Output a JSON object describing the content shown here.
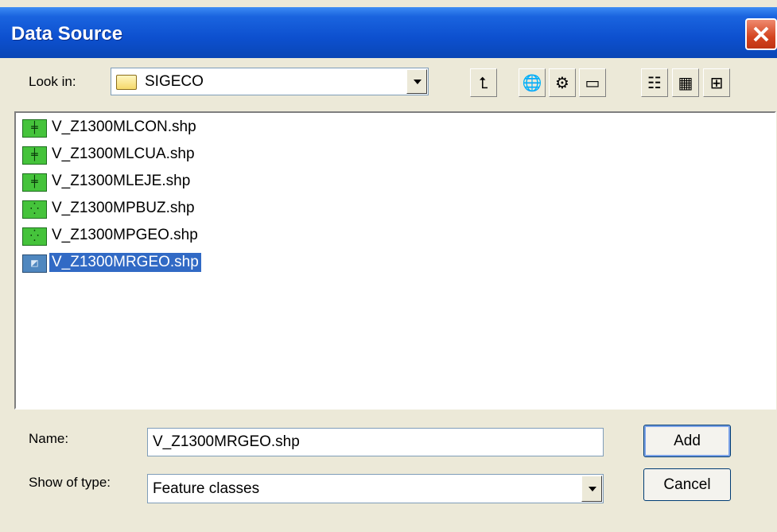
{
  "window": {
    "title": "Data Source"
  },
  "look_in": {
    "label": "Look in:",
    "value": "SIGECO"
  },
  "toolbar": [
    {
      "name": "up-one-level-button",
      "icon": "up-folder-icon",
      "glyph": "⮤"
    },
    {
      "name": "connect-folder-button",
      "icon": "connect-folder-icon",
      "glyph": "🌐"
    },
    {
      "name": "disconnect-folder-button",
      "icon": "disconnect-folder-icon",
      "glyph": "⚙"
    },
    {
      "name": "new-folder-button",
      "icon": "new-folder-icon",
      "glyph": "▭"
    },
    {
      "name": "list-view-button",
      "icon": "list-view-icon",
      "glyph": "☷"
    },
    {
      "name": "details-view-button",
      "icon": "details-view-icon",
      "glyph": "▦"
    },
    {
      "name": "thumbnails-view-button",
      "icon": "thumbnails-view-icon",
      "glyph": "⊞"
    }
  ],
  "files": [
    {
      "name": "V_Z1300MLCON.shp",
      "icon": "line-feature-icon",
      "glyph": "╪",
      "type": "line",
      "selected": false
    },
    {
      "name": "V_Z1300MLCUA.shp",
      "icon": "line-feature-icon",
      "glyph": "╪",
      "type": "line",
      "selected": false
    },
    {
      "name": "V_Z1300MLEJE.shp",
      "icon": "line-feature-icon",
      "glyph": "╪",
      "type": "line",
      "selected": false
    },
    {
      "name": "V_Z1300MPBUZ.shp",
      "icon": "point-feature-icon",
      "glyph": "⁛",
      "type": "point",
      "selected": false
    },
    {
      "name": "V_Z1300MPGEO.shp",
      "icon": "point-feature-icon",
      "glyph": "⁛",
      "type": "point",
      "selected": false
    },
    {
      "name": "V_Z1300MRGEO.shp",
      "icon": "raster-feature-icon",
      "glyph": "◩",
      "type": "raster",
      "selected": true
    }
  ],
  "name_field": {
    "label": "Name:",
    "value": "V_Z1300MRGEO.shp"
  },
  "type_field": {
    "label": "Show of type:",
    "value": "Feature classes"
  },
  "buttons": {
    "add": "Add",
    "cancel": "Cancel"
  },
  "colors": {
    "titlebar": "#0d50cf",
    "selection": "#316ac5",
    "dialog_bg": "#ece9d8"
  }
}
